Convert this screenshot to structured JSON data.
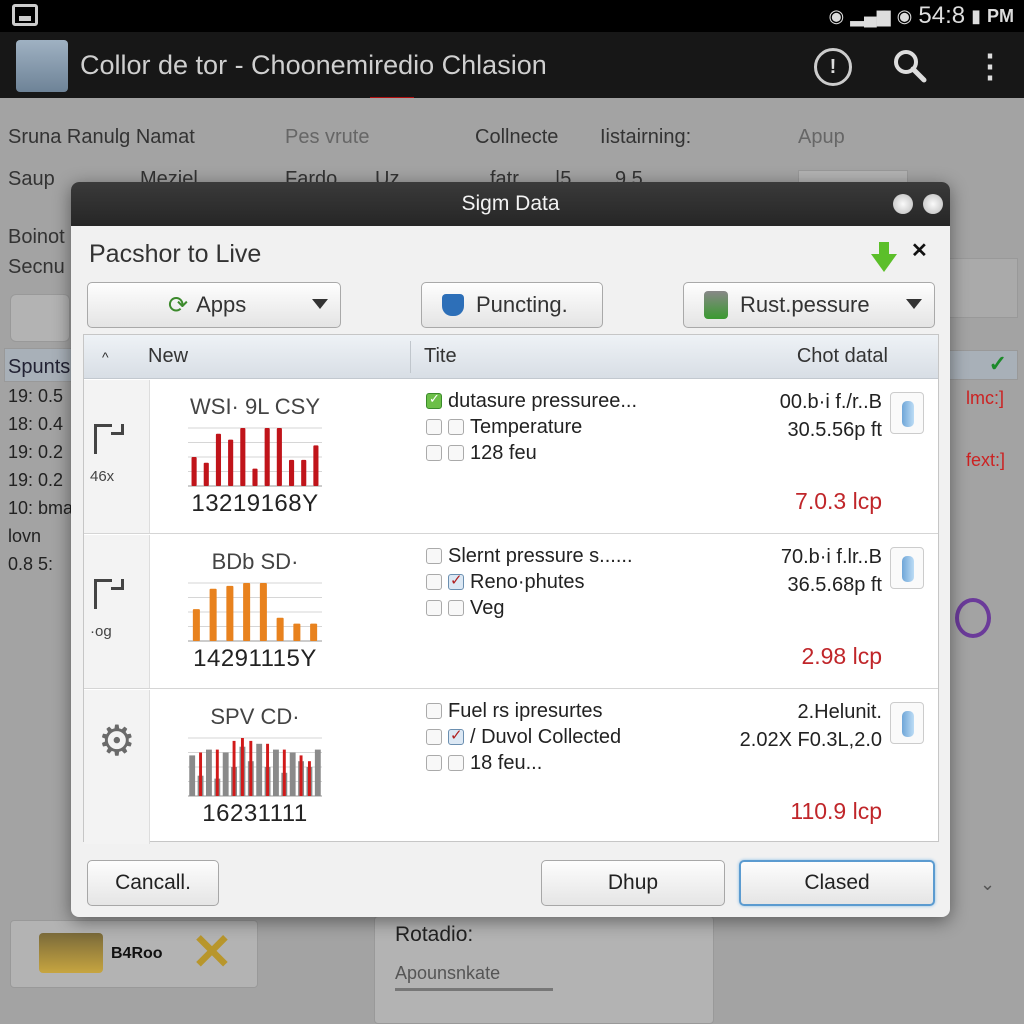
{
  "status_bar": {
    "time": "54:8",
    "am_pm": "PM",
    "icons": [
      "lock-icon",
      "wifi-icon",
      "signal-icon",
      "wifi-icon",
      "battery-icon"
    ]
  },
  "app_bar": {
    "title": "Collor de tor - Choonemiredio Chlasion",
    "icons": [
      "app-icon",
      "info-icon",
      "search-icon",
      "more-vert-icon"
    ]
  },
  "background": {
    "headers": [
      "Sruna Ranulg Namat",
      "Pes vrute",
      "Collnecte",
      "Iistairning:",
      "Apup"
    ],
    "row1": [
      "Saup",
      "Meziel",
      "Fardo",
      "Uz",
      "fatr",
      "|5",
      "9.5"
    ],
    "left_labels": [
      "Boinot",
      "Secnu"
    ],
    "list_header": "Spunts",
    "list_items": [
      "19: 0.5",
      "18: 0.4",
      "19: 0.2",
      "19: 0.2",
      "10: bma",
      "lovn",
      "0.8 5:"
    ],
    "right_marks": [
      "lmc:]",
      "fext:]"
    ],
    "bottom_left_caption": "B4Roo",
    "bottom_box_label": "Rotadio:",
    "bottom_box_link": "Apounsnkate"
  },
  "dialog": {
    "title": "Sigm Data",
    "heading": "Pacshor to Live",
    "toolbar": {
      "apps_label": "Apps",
      "punching_label": "Puncting.",
      "pressure_label": "Rust.pessure"
    },
    "table": {
      "columns": [
        "New",
        "Tite",
        "Chot datal"
      ],
      "rows": [
        {
          "side_label": "46x",
          "chart_title": "WSI· 9L CSY",
          "chart_number": "13219168Y",
          "items": [
            {
              "label": "dutasure pressuree...",
              "check": "green"
            },
            {
              "label": "Temperature",
              "check": "none"
            },
            {
              "label": "128 feu",
              "check": "none"
            }
          ],
          "values": [
            "00.b·i f./r..B",
            "30.5.56p ft"
          ],
          "total": "7.0.3 lcp"
        },
        {
          "side_label": "·og",
          "chart_title": "BDb SD·",
          "chart_number": "14291115Y",
          "items": [
            {
              "label": "Slernt pressure s......",
              "check": "none"
            },
            {
              "label": "Reno·phutes",
              "check": "checked"
            },
            {
              "label": "Veg",
              "check": "none"
            }
          ],
          "values": [
            "70.b·i f.lr..B",
            "36.5.68p ft"
          ],
          "total": "2.98 lcp"
        },
        {
          "side_label": "",
          "chart_title": "SPV CD·",
          "chart_number": "16231111",
          "items": [
            {
              "label": "Fuel rs ipresurtes",
              "check": "none"
            },
            {
              "label": "/ Duvol Collected",
              "check": "checked"
            },
            {
              "label": "18 feu...",
              "check": "none"
            }
          ],
          "values": [
            "2.Helunit.",
            "2.02X F0.3L,2.0"
          ],
          "total": "110.9 lcp"
        }
      ]
    },
    "footer": {
      "cancel_label": "Cancall.",
      "secondary_label": "Dhup",
      "primary_label": "Clased"
    }
  },
  "chart_data": [
    {
      "type": "bar",
      "title": "WSI· 9L CSY",
      "color": "#c0141a",
      "values": [
        0.5,
        0.4,
        0.9,
        0.8,
        1.0,
        0.3,
        1.0,
        1.0,
        0.45,
        0.45,
        0.7
      ],
      "ylim": [
        0,
        1
      ]
    },
    {
      "type": "bar",
      "title": "BDb SD·",
      "color": "#e8821e",
      "values": [
        0.55,
        0.9,
        0.95,
        1.0,
        1.0,
        0.4,
        0.3,
        0.3
      ],
      "ylim": [
        0,
        1
      ]
    },
    {
      "type": "bar",
      "title": "SPV CD·",
      "colors": [
        "#8a8a8a",
        "#d11a1a"
      ],
      "series": [
        {
          "name": "gray",
          "values": [
            0.7,
            0.35,
            0.8,
            0.3,
            0.75,
            0.5,
            0.85,
            0.6,
            0.9,
            0.5,
            0.8,
            0.4,
            0.75,
            0.6,
            0.5,
            0.8
          ]
        },
        {
          "name": "red",
          "values": [
            0,
            0.75,
            0,
            0.8,
            0,
            0.95,
            1.0,
            0.95,
            0,
            0.9,
            0,
            0.8,
            0,
            0.7,
            0.6,
            0
          ]
        }
      ],
      "ylim": [
        0,
        1
      ]
    }
  ]
}
